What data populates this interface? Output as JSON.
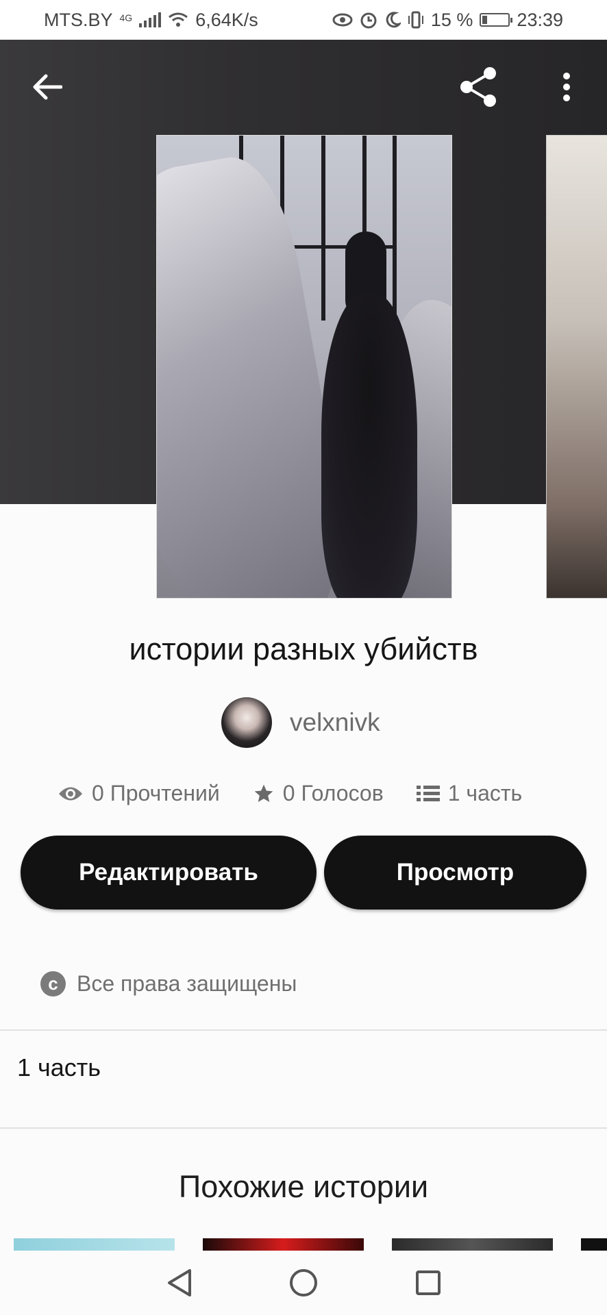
{
  "status_bar": {
    "carrier": "MTS.BY",
    "network": "4G",
    "speed": "6,64K/s",
    "battery": "15 %",
    "time": "23:39"
  },
  "toolbar": {
    "back_icon": "arrow-left-icon",
    "share_icon": "share-icon",
    "menu_icon": "more-vertical-icon"
  },
  "story": {
    "title": "истории разных убийств",
    "author": "velxnivk",
    "reads": "0 Прочтений",
    "votes": "0 Голосов",
    "parts": "1 часть"
  },
  "actions": {
    "edit_label": "Редактировать",
    "view_label": "Просмотр"
  },
  "license": "Все права защищены",
  "table_of_contents": {
    "parts_label": "1 часть"
  },
  "similar": {
    "title": "Похожие истории"
  },
  "colors": {
    "button_bg": "#121212",
    "hero_bg": "#2f2e30",
    "secondary_text": "#6f6f6f"
  }
}
